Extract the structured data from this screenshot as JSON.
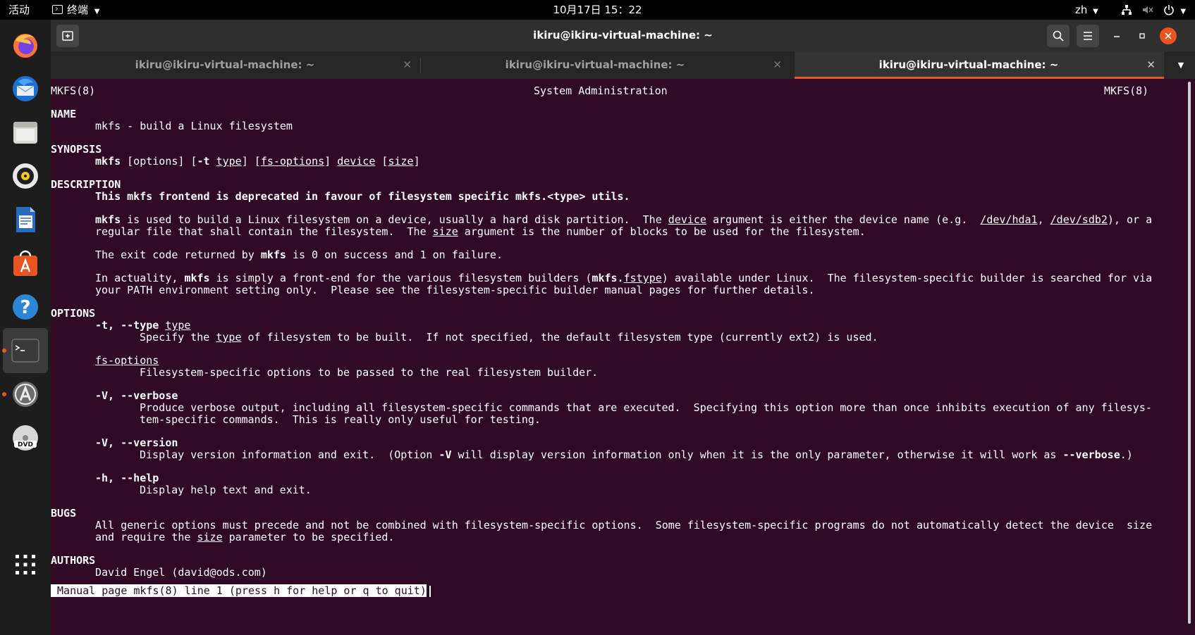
{
  "topbar": {
    "activities": "活动",
    "app_menu": "终端",
    "clock": "10月17日 15：22",
    "language": "zh"
  },
  "dock": {
    "items": [
      "firefox-icon",
      "thunderbird-icon",
      "files-icon",
      "rhythmbox-icon",
      "libreoffice-writer-icon",
      "software-icon",
      "help-icon",
      "terminal-icon",
      "updater-icon",
      "dvd-icon",
      "show-apps-icon"
    ]
  },
  "window": {
    "title": "ikiru@ikiru-virtual-machine: ~",
    "tabs": [
      {
        "label": "ikiru@ikiru-virtual-machine: ~"
      },
      {
        "label": "ikiru@ikiru-virtual-machine: ~"
      },
      {
        "label": "ikiru@ikiru-virtual-machine: ~"
      }
    ]
  },
  "man": {
    "header_left": "MKFS(8)",
    "header_center": "System Administration",
    "header_right": "MKFS(8)",
    "h_name": "NAME",
    "name_text": "mkfs - build a Linux filesystem",
    "h_synopsis": "SYNOPSIS",
    "h_description": "DESCRIPTION",
    "deprecated": "This mkfs frontend is deprecated in favour of filesystem specific mkfs.<type> utils.",
    "exit_code_pre": "The exit code returned by ",
    "exit_code_post": " is 0 on success and 1 on failure.",
    "h_options": "OPTIONS",
    "opt_fsoptions": "fs-options",
    "opt_fsoptions_desc": "Filesystem-specific options to be passed to the real filesystem builder.",
    "opt_verbose": "-V, --verbose",
    "opt_verbose_desc1": "Produce verbose output, including all filesystem-specific commands that are executed.  Specifying this option more than once inhibits execution of any filesys‐",
    "opt_verbose_desc2": "tem-specific commands.  This is really only useful for testing.",
    "opt_version": "-V, --version",
    "opt_help": "-h, --help",
    "opt_help_desc": "Display help text and exit.",
    "h_bugs": "BUGS",
    "bugs1": "All generic options must precede and not be combined with filesystem-specific options.  Some filesystem-specific programs do not automatically detect the device  size",
    "h_authors": "AUTHORS",
    "author": "David Engel (david@ods.com)",
    "status_line": " Manual page mkfs(8) line 1 (press h for help or q to quit)"
  },
  "colors": {
    "terminal_bg": "#300a24",
    "accent": "#e95420",
    "dock_bg": "#1d1d1d",
    "topbar_bg": "#000000"
  }
}
